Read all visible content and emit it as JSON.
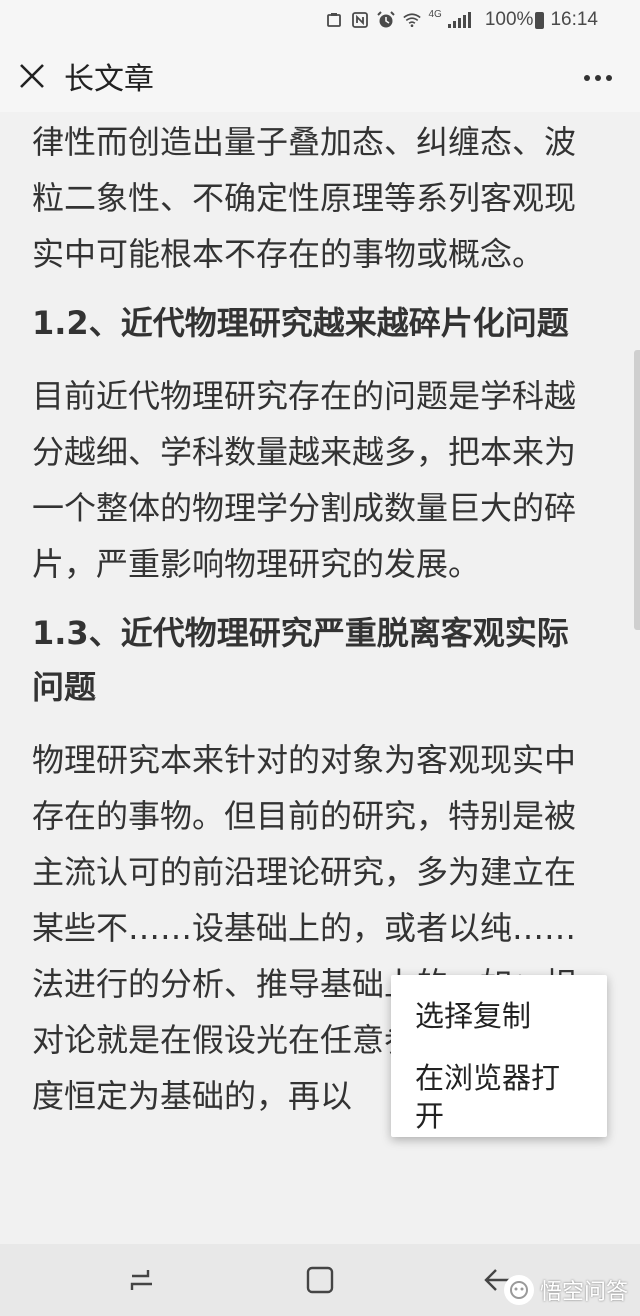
{
  "status_bar": {
    "lte": "4G",
    "battery": "100%",
    "time": "16:14"
  },
  "header": {
    "title": "长文章"
  },
  "article": {
    "blocks": [
      {
        "type": "para",
        "text": "律性而创造出量子叠加态、纠缠态、波粒二象性、不确定性原理等系列客观现实中可能根本不存在的事物或概念。"
      },
      {
        "type": "heading",
        "text": "1.2、近代物理研究越来越碎片化问题"
      },
      {
        "type": "para",
        "text": "目前近代物理研究存在的问题是学科越分越细、学科数量越来越多，把本来为一个整体的物理学分割成数量巨大的碎片，严重影响物理研究的发展。"
      },
      {
        "type": "heading",
        "text": "1.3、近代物理研究严重脱离客观实际问题"
      },
      {
        "type": "para",
        "text": "物理研究本来针对的对象为客观现实中存在的事物。但目前的研究，特别是被主流认可的前沿理论研究，多为建立在某些不……设基础上的，或者以纯……法进行的分析、推导基础上的。如：相对论就是在假设光在任意参照系中的速度恒定为基础的，再以"
      }
    ]
  },
  "context_menu": {
    "items": [
      "选择复制",
      "在浏览器打开"
    ]
  },
  "watermark": {
    "text": "悟空问答"
  },
  "colors": {
    "background": "#f1f1f1",
    "text": "#333333",
    "bar": "#f6f6f6",
    "nav": "#e8e8e8"
  }
}
